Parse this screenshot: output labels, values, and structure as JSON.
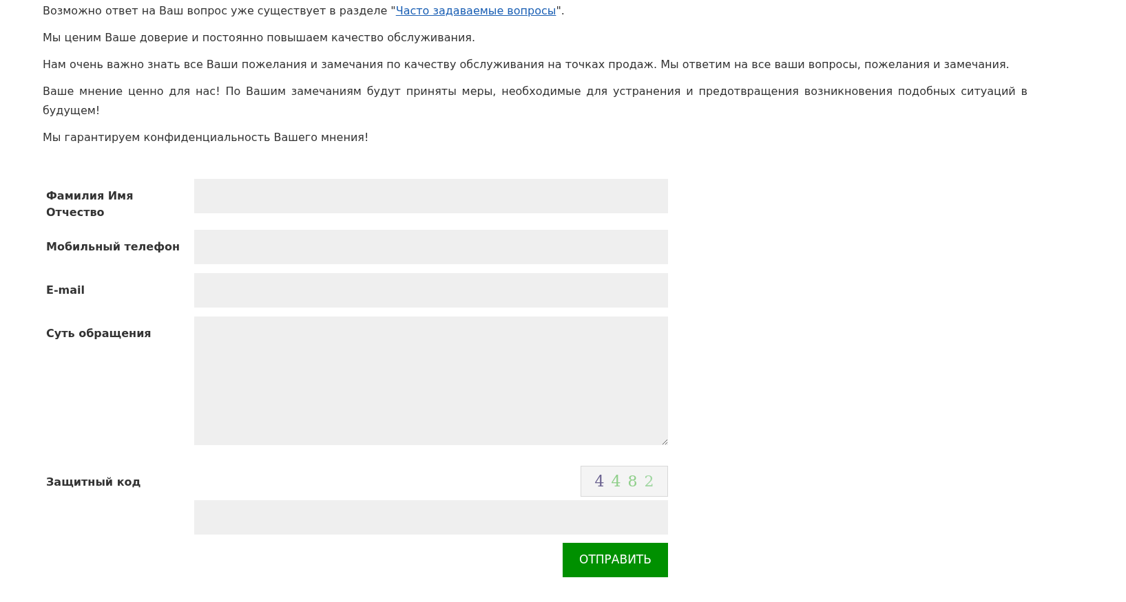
{
  "intro": {
    "before": "Возможно ответ на Ваш вопрос уже существует в разделе \"",
    "link": "Часто задаваемые вопросы",
    "after": "\"."
  },
  "paragraphs": [
    "Мы ценим Ваше доверие и постоянно повышаем качество обслуживания.",
    "Нам очень важно знать все Ваши пожелания и замечания по качеству обслуживания на точках продаж. Мы ответим на все ваши вопросы, пожелания и замечания.",
    "Ваше мнение ценно для нас! По Вашим замечаниям будут приняты меры, необходимые для устранения и предотвращения возникновения подобных ситуаций в будущем!",
    "Мы гарантируем конфиденциальность Вашего мнения!"
  ],
  "form": {
    "fields": [
      {
        "label": "Фамилия Имя Отчество",
        "kind": "input"
      },
      {
        "label": "Мобильный телефон",
        "kind": "input"
      },
      {
        "label": "E-mail",
        "kind": "input"
      },
      {
        "label": "Суть обращения",
        "kind": "textarea"
      }
    ],
    "captcha": {
      "label": "Защитный код",
      "digits": [
        {
          "text": "4",
          "color": "#6b6290"
        },
        {
          "text": "4",
          "color": "#8fcf8a"
        },
        {
          "text": "8",
          "color": "#8fcf8a"
        },
        {
          "text": "2",
          "color": "#9fd6a0"
        }
      ]
    },
    "submit": "ОТПРАВИТЬ"
  }
}
